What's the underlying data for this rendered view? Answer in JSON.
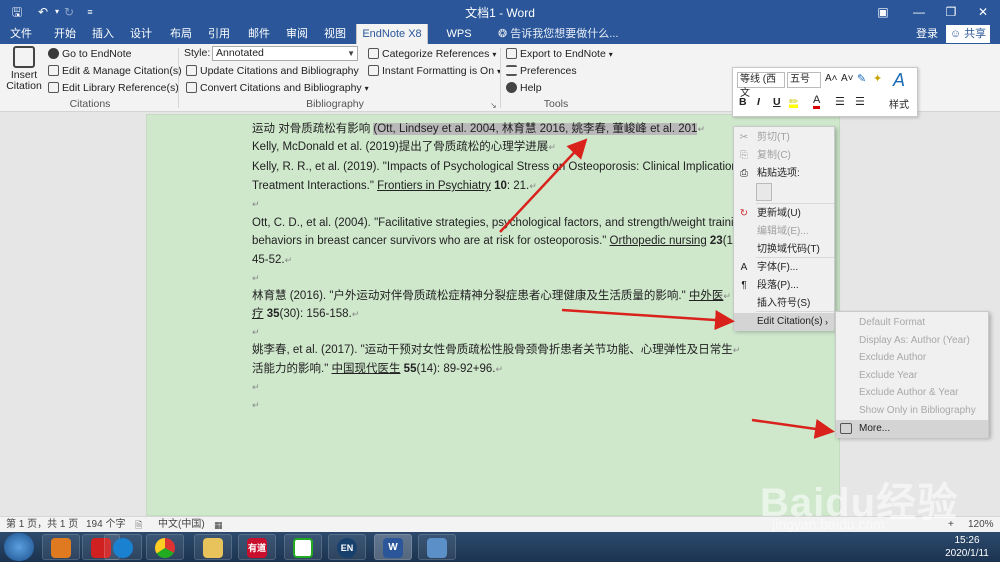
{
  "titlebar": {
    "title": "文档1 - Word",
    "save_icon": "save-icon",
    "undo_icon": "undo-icon",
    "redo_icon": "redo-icon",
    "customize_icon": "customize-icon",
    "ribbon_options_icon": "ribbon-display-icon",
    "minimize_icon": "minimize-icon",
    "restore_icon": "restore-icon",
    "close_icon": "close-icon"
  },
  "tabs": [
    "文件",
    "开始",
    "插入",
    "设计",
    "布局",
    "引用",
    "邮件",
    "审阅",
    "视图",
    "EndNote X8",
    "WPS PDF"
  ],
  "active_tab": "EndNote X8",
  "tell_me": "告诉我您想要做什么...",
  "account": {
    "login": "登录",
    "share": "共享"
  },
  "ribbon": {
    "insert_citation": [
      "Insert",
      "Citation"
    ],
    "citations_group": {
      "label": "Citations",
      "items": [
        "Go to EndNote",
        "Edit & Manage Citation(s)",
        "Edit Library Reference(s)"
      ]
    },
    "bibliography_group": {
      "label": "Bibliography",
      "style_label": "Style:",
      "style_value": "Annotated",
      "items": [
        "Update Citations and Bibliography",
        "Convert Citations and Bibliography"
      ],
      "items_right": [
        "Categorize References",
        "Instant Formatting is On"
      ]
    },
    "tools_group": {
      "label": "Tools",
      "items": [
        "Export to EndNote",
        "Preferences",
        "Help"
      ]
    }
  },
  "mini_toolbar": {
    "font": "等线 (西文",
    "size": "五号",
    "styles_label": "样式",
    "buttons": [
      "B",
      "I",
      "U"
    ]
  },
  "document": {
    "lines": [
      {
        "pre": "运动 对骨质疏松有影响 ",
        "hl": "(Ott, Lindsey et al. 2004, 林育慧 2016, 姚李春, 董峻峰 et al. 201",
        "post": ""
      },
      {
        "pre": "Kelly, McDonald et al. (2019)提出了骨质疏松的心理学进展",
        "hl": "",
        "post": ""
      },
      {
        "pre": "Kelly, R. R., et al. (2019). \"Impacts of Psychological Stress on Osteoporosis: Clinical Implications and",
        "hl": "",
        "post": ""
      },
      {
        "pre": "Treatment Interactions.\" ",
        "u": "Frontiers in Psychiatry",
        "b": " 10",
        "post": ": 21."
      },
      {
        "pre": "",
        "hl": "",
        "post": ""
      },
      {
        "pre": "Ott, C. D., et al. (2004). \"Facilitative strategies, psychological factors, and strength/weight training",
        "hl": "",
        "post": ""
      },
      {
        "pre": "behaviors in breast cancer survivors who are at risk for osteoporosis.\" ",
        "u": "Orthopedic nursing",
        "b": " 23",
        "post": "(1)"
      },
      {
        "pre": "45-52.",
        "hl": "",
        "post": ""
      },
      {
        "pre": "",
        "hl": "",
        "post": ""
      },
      {
        "pre": "林育慧 (2016). \"户外运动对伴骨质疏松症精神分裂症患者心理健康及生活质量的影响.\" ",
        "u": "中外医",
        "post": ""
      },
      {
        "pre": "",
        "u": "疗",
        "b": " 35",
        "post": "(30): 156-158."
      },
      {
        "pre": "",
        "hl": "",
        "post": ""
      },
      {
        "pre": "姚李春, et al. (2017). \"运动干预对女性骨质疏松性股骨颈骨折患者关节功能、心理弹性及日常生",
        "hl": "",
        "post": ""
      },
      {
        "pre": "活能力的影响.\" ",
        "u": "中国现代医生",
        "b": " 55",
        "post": "(14): 89-92+96."
      },
      {
        "pre": "",
        "hl": "",
        "post": ""
      },
      {
        "pre": "",
        "hl": "",
        "post": ""
      }
    ]
  },
  "context_menu": {
    "items": [
      {
        "label": "剪切(T)",
        "icon": "cut-icon",
        "enabled": false
      },
      {
        "label": "复制(C)",
        "icon": "copy-icon",
        "enabled": false
      },
      {
        "label": "粘贴选项:",
        "icon": "paste-icon",
        "enabled": true
      },
      {
        "label": "更新域(U)",
        "icon": "update-field-icon",
        "enabled": true
      },
      {
        "label": "编辑域(E)...",
        "icon": "",
        "enabled": false
      },
      {
        "label": "切换域代码(T)",
        "icon": "",
        "enabled": true
      },
      {
        "label": "字体(F)...",
        "icon": "font-icon",
        "enabled": true
      },
      {
        "label": "段落(P)...",
        "icon": "paragraph-icon",
        "enabled": true
      },
      {
        "label": "插入符号(S)",
        "icon": "",
        "enabled": true
      },
      {
        "label": "Edit Citation(s)",
        "icon": "",
        "enabled": true
      }
    ]
  },
  "submenu": {
    "items": [
      {
        "label": "Default Format",
        "enabled": false
      },
      {
        "label": "Display As: Author (Year)",
        "enabled": false
      },
      {
        "label": "Exclude Author",
        "enabled": false
      },
      {
        "label": "Exclude Year",
        "enabled": false
      },
      {
        "label": "Exclude Author & Year",
        "enabled": false
      },
      {
        "label": "Show Only in Bibliography",
        "enabled": false
      },
      {
        "label": "More...",
        "enabled": true
      }
    ]
  },
  "statusbar": {
    "page": "第 1 页，共 1 页",
    "words": "194 个字",
    "lang": "中文(中国)",
    "zoom": "120%"
  },
  "taskbar": {
    "apps": [
      "有道",
      "EN"
    ],
    "time": "15:26",
    "date": "2020/1/11"
  },
  "watermark": {
    "brand": "Baidu经验",
    "url": "jingyan.baidu.com"
  },
  "colors": {
    "word_blue": "#2b579a",
    "arrow_red": "#d9221c",
    "doc_green": "#cfe8cc"
  }
}
